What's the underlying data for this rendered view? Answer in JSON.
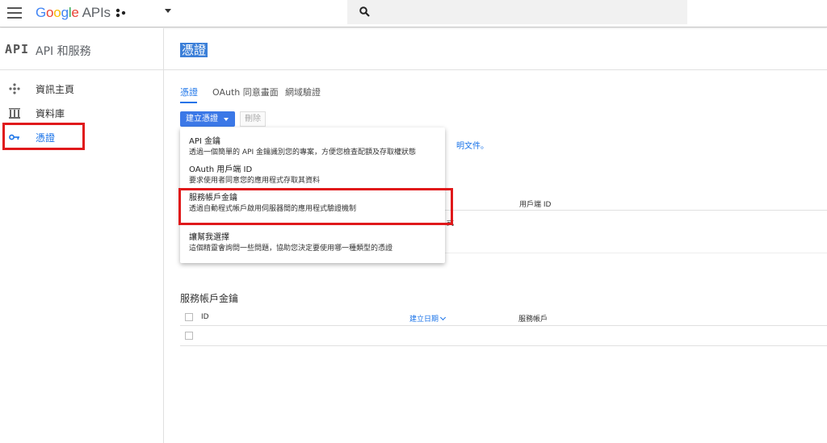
{
  "topbar": {
    "brand_letters": [
      "G",
      "o",
      "o",
      "g",
      "l",
      "e"
    ],
    "brand_suffix": "APIs",
    "search_placeholder": ""
  },
  "sidebar": {
    "logo": "API",
    "title": "API 和服務",
    "items": [
      {
        "label": "資訊主頁",
        "icon": "dashboard-icon"
      },
      {
        "label": "資料庫",
        "icon": "library-icon"
      },
      {
        "label": "憑證",
        "icon": "key-icon",
        "active": true
      }
    ]
  },
  "main": {
    "title": "憑證",
    "tabs": [
      {
        "label": "憑證",
        "active": true
      },
      {
        "label": "OAuth 同意畫面"
      },
      {
        "label": "網域驗證"
      }
    ],
    "create_button": "建立憑證",
    "delete_button": "刪除",
    "background_doc_link": "明文件。",
    "background_col_client_id": "用戶端 ID",
    "background_partial_text": "式"
  },
  "dropdown": {
    "items": [
      {
        "title": "API 金鑰",
        "desc": "透過一個簡單的 API 金鑰識別您的專案，方便您檢查配額及存取權狀態"
      },
      {
        "title": "OAuth 用戶端 ID",
        "desc": "要求使用者同意您的應用程式存取其資料"
      },
      {
        "title": "服務帳戶金鑰",
        "desc": "透過自動程式帳戶啟用伺服器間的應用程式驗證機制"
      },
      {
        "title": "讓幫我選擇",
        "desc": "這個精靈會詢問一些問題，協助您決定要使用哪一種類型的憑證"
      }
    ]
  },
  "service_account_keys": {
    "title": "服務帳戶金鑰",
    "columns": [
      "ID",
      "建立日期",
      "服務帳戶"
    ]
  },
  "colors": {
    "accent": "#1a73e8",
    "primary_button": "#3b78e7",
    "highlight_box": "#e0191b"
  }
}
